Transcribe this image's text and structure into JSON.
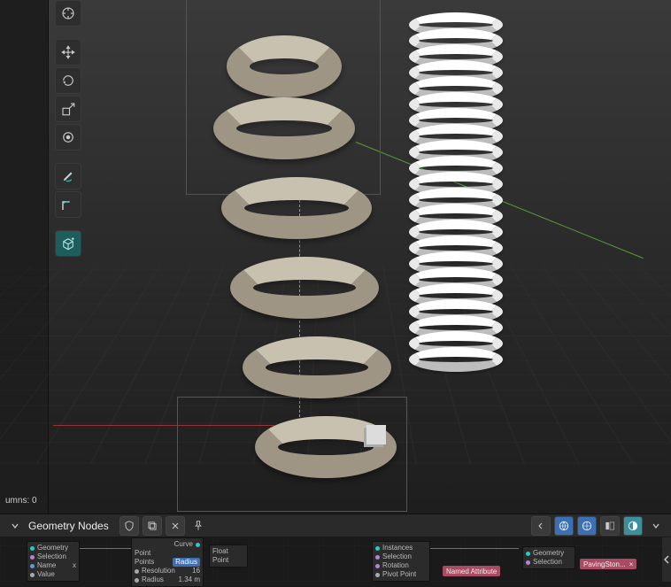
{
  "viewport": {
    "left_strip_present": true,
    "axes": {
      "x_color": "#c83c3c",
      "y_color": "#64b43c"
    },
    "bounding_boxes": 2
  },
  "toolbar": {
    "items": [
      {
        "name": "cursor-tool",
        "icon": "cursor"
      },
      {
        "name": "move-tool",
        "icon": "move"
      },
      {
        "name": "rotate-tool",
        "icon": "rotate"
      },
      {
        "name": "scale-tool",
        "icon": "scale"
      },
      {
        "name": "transform-tool",
        "icon": "transform"
      },
      {
        "name": "annotate-tool",
        "icon": "annotate"
      },
      {
        "name": "measure-tool",
        "icon": "measure"
      },
      {
        "name": "add-cube-tool",
        "icon": "cube",
        "highlight": true
      }
    ]
  },
  "status": {
    "columns_label": "umns: 0"
  },
  "node_editor": {
    "title": "Geometry Nodes",
    "header_icons": {
      "shield": "shield-icon",
      "duplicate": "duplicate-icon",
      "close": "close-icon",
      "pin": "pin-icon"
    },
    "right_icons": {
      "arrow": "arrow-icon",
      "globe1": "globe-icon",
      "globe2": "globe-icon",
      "tool_left": "panel-left-icon",
      "tool_right": "panel-right-icon"
    },
    "nodes": {
      "n1_rows": [
        "Geometry",
        "Selection",
        "Name",
        "Value"
      ],
      "n1_name_value": "x",
      "n2_header": "Curve",
      "n2_rows": [
        "Point",
        "Points",
        "Resolution",
        "Radius"
      ],
      "n2_points_value": "Radius",
      "n2_resolution_value": "16",
      "n2_radius_value": "1.34 m",
      "n3_rows": [
        "Float",
        "Point"
      ],
      "n4_rows": [
        "Instances",
        "Selection",
        "Rotation",
        "Pivot Point"
      ],
      "n5_rows": [
        "Geometry",
        "Selection"
      ],
      "badge1_label": "Named Attribute",
      "badge2_label": "PavingSton..."
    }
  }
}
